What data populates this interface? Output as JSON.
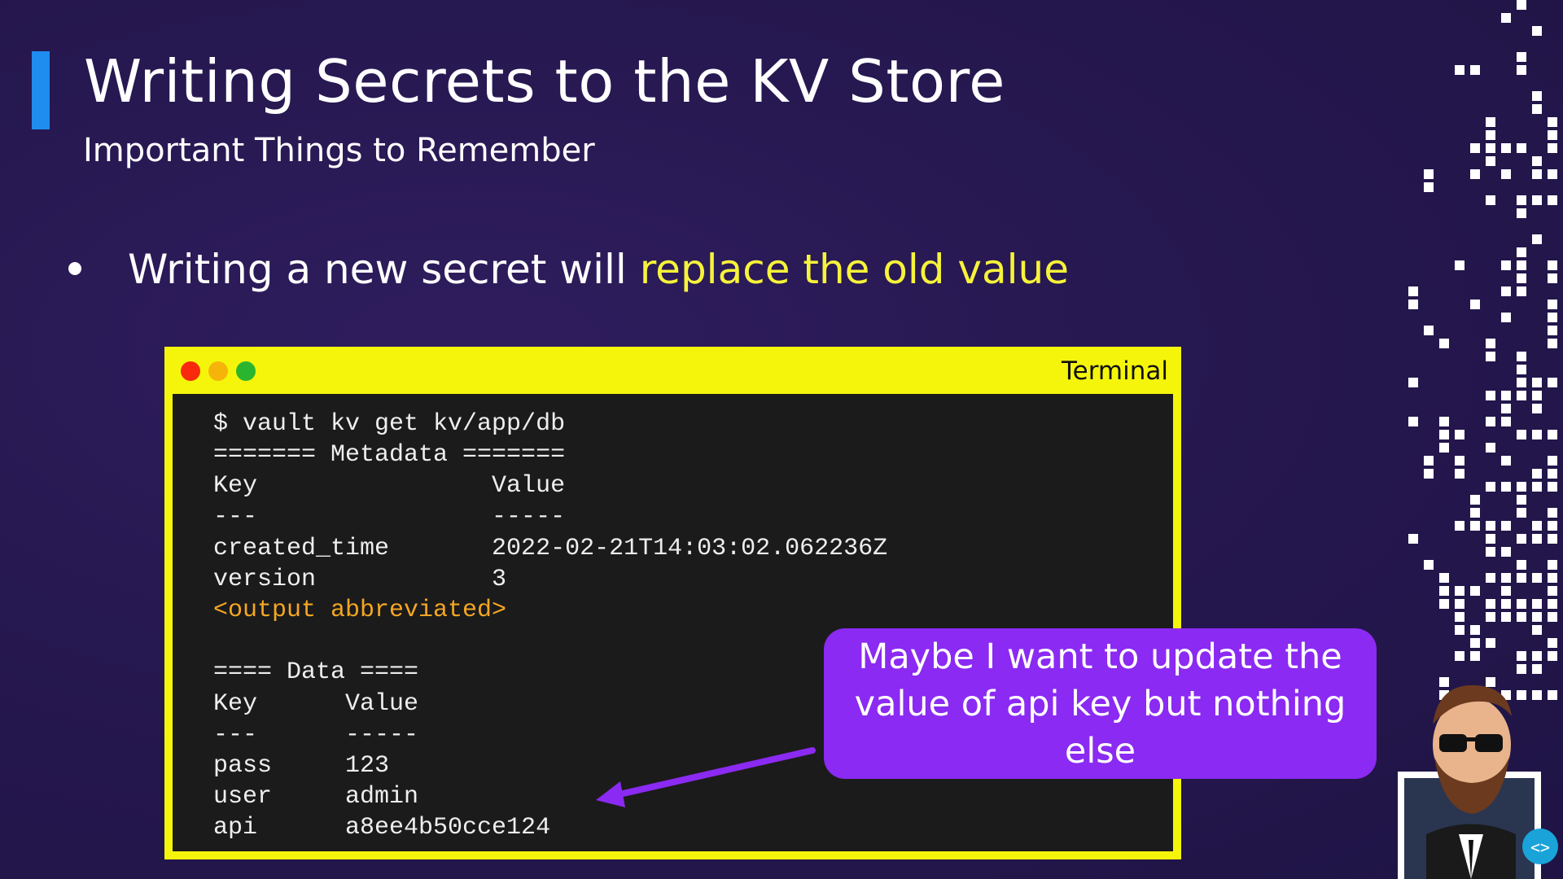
{
  "slide": {
    "title": "Writing Secrets to the KV Store",
    "subtitle": "Important Things to Remember",
    "bullet": {
      "text_before": "Writing a new secret will ",
      "text_highlight": "replace the old value"
    },
    "colors": {
      "background": "#261850",
      "accent_bar": "#1f8cf0",
      "highlight": "#f7f33a",
      "terminal_frame": "#f5f50c",
      "callout": "#8b2af2"
    }
  },
  "terminal": {
    "title": "Terminal",
    "window_buttons": [
      "close",
      "minimize",
      "maximize"
    ],
    "lines": [
      "$ vault kv get kv/app/db",
      "======= Metadata =======",
      "Key                Value",
      "---                -----",
      "created_time       2022-02-21T14:03:02.062236Z",
      "version            3",
      "<output abbreviated>",
      "",
      "==== Data ====",
      "Key      Value",
      "---      -----",
      "pass     123",
      "user     admin",
      "api      a8ee4b50cce124"
    ]
  },
  "callout": {
    "text": "Maybe I want to update the value of api key but nothing else"
  },
  "icons": {
    "avatar": "presenter-avatar-icon",
    "logo": "code-cloud-icon"
  }
}
